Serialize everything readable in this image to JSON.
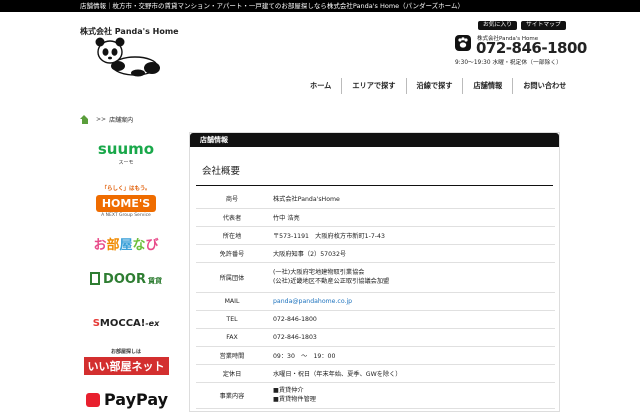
{
  "topbar": {
    "text": "店舗情報｜枚方市・交野市の賃貸マンション・アパート・一戸建てのお部屋探しなら株式会社Panda's Home（パンダーズホーム）"
  },
  "logo": {
    "text": "株式会社 Panda's Home"
  },
  "header": {
    "buttons": [
      "お気に入り",
      "サイトマップ"
    ],
    "company": "株式会社Panda's Home",
    "tel": "072-846-1800",
    "hours": "9:30〜19:30 水曜・祝定休（一部除く）"
  },
  "nav": {
    "items": [
      "ホーム",
      "エリアで探す",
      "沿線で探す",
      "店舗情報",
      "お問い合わせ"
    ]
  },
  "breadcrumb": {
    "separator": ">>",
    "current": "店舗案内"
  },
  "sidebar": {
    "suumo": {
      "name": "suumo",
      "sub": "スーモ"
    },
    "homes": {
      "tag": "「らしく」はもう。",
      "name": "HOME'S",
      "sub": "A NEXT Group Service"
    },
    "oheya": {
      "chars": [
        "お",
        "部",
        "屋",
        "な",
        "び"
      ]
    },
    "door": {
      "name": "DOOR",
      "sub": "賃貸"
    },
    "smocca": {
      "s": "S",
      "name": "MOCCA!",
      "ex": "-ex"
    },
    "iiheya": {
      "small": "お部屋探しは",
      "name": "いい部屋ネット"
    },
    "paypay": {
      "name": "PayPay"
    }
  },
  "panel": {
    "heading": "店舗情報",
    "section_title": "会社概要",
    "rows": [
      {
        "label": "商号",
        "value": "株式会社Panda'sHome"
      },
      {
        "label": "代表者",
        "value": "竹中 浩亮"
      },
      {
        "label": "所在地",
        "value": "〒573-1191　大阪府枚方市新町1-7-43"
      },
      {
        "label": "免許番号",
        "value": "大阪府知事（2）57032号"
      },
      {
        "label": "所属団体",
        "value": "(一社)大阪府宅地建物取引業協会\n(公社)近畿地区不動産公正取引協議会加盟"
      },
      {
        "label": "MAIL",
        "value": "panda@pandahome.co.jp"
      },
      {
        "label": "TEL",
        "value": "072-846-1800"
      },
      {
        "label": "FAX",
        "value": "072-846-1803"
      },
      {
        "label": "営業時間",
        "value": "09：30　〜　19：00"
      },
      {
        "label": "定休日",
        "value": "水曜日・祝日（年末年始、夏季、GWを除く）"
      },
      {
        "label": "事業内容",
        "value": "■賃貸仲介\n■賃貸物件管理"
      }
    ]
  },
  "colors": {
    "topbar": "#000000",
    "panel_head": "#111111",
    "link": "#1e73be",
    "suumo": "#19a84a",
    "homes": "#ef6c00"
  }
}
